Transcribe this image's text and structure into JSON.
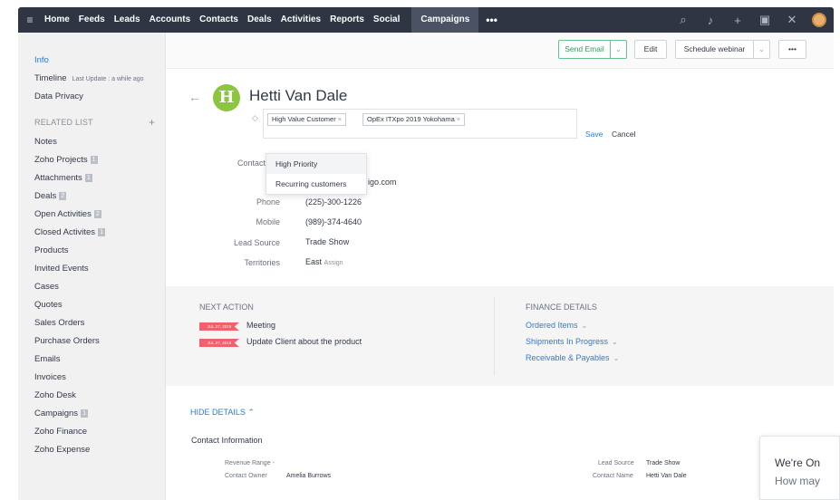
{
  "topnav": {
    "items": [
      "Home",
      "Feeds",
      "Leads",
      "Accounts",
      "Contacts",
      "Deals",
      "Activities",
      "Reports",
      "Social"
    ],
    "active": "Campaigns",
    "more": "•••"
  },
  "sidebar": {
    "info": "Info",
    "timeline": "Timeline",
    "timeline_sub": "Last Update : a while ago",
    "data_privacy": "Data Privacy",
    "related_list": "RELATED LIST",
    "items": [
      {
        "label": "Notes",
        "badge": ""
      },
      {
        "label": "Zoho Projects",
        "badge": "1"
      },
      {
        "label": "Attachments",
        "badge": "1"
      },
      {
        "label": "Deals",
        "badge": "2"
      },
      {
        "label": "Open Activities",
        "badge": "2"
      },
      {
        "label": "Closed Activites",
        "badge": "1"
      },
      {
        "label": "Products",
        "badge": ""
      },
      {
        "label": "Invited Events",
        "badge": ""
      },
      {
        "label": "Cases",
        "badge": ""
      },
      {
        "label": "Quotes",
        "badge": ""
      },
      {
        "label": "Sales Orders",
        "badge": ""
      },
      {
        "label": "Purchase Orders",
        "badge": ""
      },
      {
        "label": "Emails",
        "badge": ""
      },
      {
        "label": "Invoices",
        "badge": ""
      },
      {
        "label": "Zoho Desk",
        "badge": ""
      },
      {
        "label": "Campaigns",
        "badge": "1"
      },
      {
        "label": "Zoho Finance",
        "badge": ""
      },
      {
        "label": "Zoho Expense",
        "badge": ""
      }
    ]
  },
  "actions": {
    "send_email": "Send Email",
    "edit": "Edit",
    "schedule_webinar": "Schedule webinar",
    "more": "•••"
  },
  "record": {
    "avatar_letter": "H",
    "name": "Hetti Van Dale",
    "tags": [
      "High Value Customer",
      "OpEx ITXpo 2019 Yokohama"
    ],
    "save": "Save",
    "cancel": "Cancel"
  },
  "tag_dropdown": [
    "High Priority",
    "Recurring customers"
  ],
  "fields": {
    "contact_owner_label": "Contact Ow",
    "email_label": "E",
    "email_value": "igo.com",
    "phone_label": "Phone",
    "phone_value": "(225)-300-1226",
    "mobile_label": "Mobile",
    "mobile_value": "(989)-374-4640",
    "lead_source_label": "Lead Source",
    "lead_source_value": "Trade Show",
    "territories_label": "Territories",
    "territories_value": "East",
    "assign": "Assign"
  },
  "next_action": {
    "heading": "NEXT ACTION",
    "items": [
      {
        "date": "JUL 27, 2019",
        "text": "Meeting"
      },
      {
        "date": "JUL 27, 2019",
        "text": "Update Client about the product"
      }
    ]
  },
  "finance": {
    "heading": "FINANCE DETAILS",
    "items": [
      "Ordered Items",
      "Shipments In Progress",
      "Receivable & Payables"
    ]
  },
  "details": {
    "hide_details": "HIDE DETAILS",
    "contact_info": "Contact Information",
    "revenue_range_label": "Revenue Range",
    "revenue_range_value": "-",
    "contact_owner_label": "Contact Owner",
    "contact_owner_value": "Amelia Burrows",
    "lead_source_label": "Lead Source",
    "lead_source_value": "Trade Show",
    "contact_name_label": "Contact Name",
    "contact_name_value": "Hetti Van Dale"
  },
  "chat": {
    "line1": "We're On",
    "line2": "How may"
  }
}
